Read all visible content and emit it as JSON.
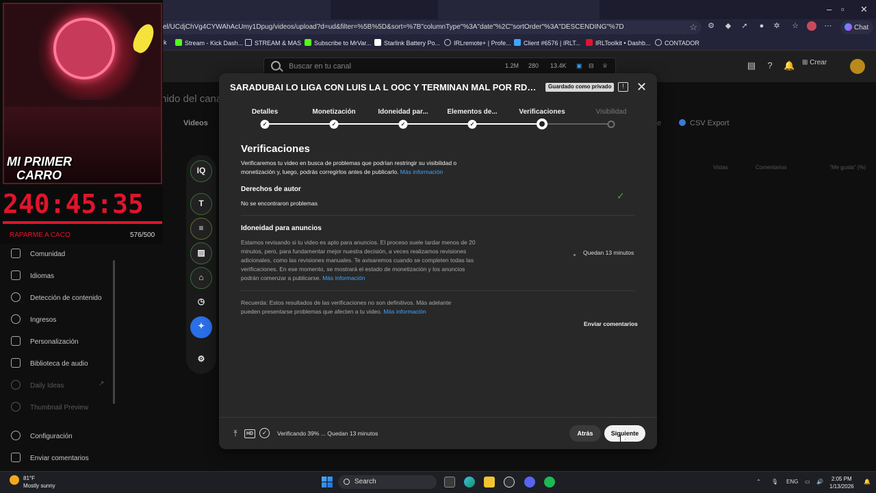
{
  "browser": {
    "url": "el/UCdjChVg4CYWAhAcUmy1Dpug/videos/upload?d=ud&filter=%5B%5D&sort=%7B\"columnType\"%3A\"date\"%2C\"sortOrder\"%3A\"DESCENDING\"%7D",
    "chat_label": "Chat",
    "bookmarks": [
      {
        "label": "Stream - Kick Dash...",
        "color": "#53fc18"
      },
      {
        "label": "STREAM & MAS",
        "color": "#cccccc"
      },
      {
        "label": "Subscribe to MrVar...",
        "color": "#53fc18"
      },
      {
        "label": "Starlink Battery Po...",
        "color": "#ffffff"
      },
      {
        "label": "IRLremote+ | Profe...",
        "color": "#cccccc"
      },
      {
        "label": "Client #6576 | IRLT...",
        "color": "#3ea6ff"
      },
      {
        "label": "IRLToolkit • Dashb...",
        "color": "#e0142c"
      },
      {
        "label": "CONTADOR",
        "color": "#cccccc"
      }
    ],
    "bookmark_prefix": "k"
  },
  "studio": {
    "search_placeholder": "Buscar en tu canal",
    "stats": {
      "subs": "1.2M",
      "videos": "280",
      "views": "13.4K"
    },
    "crear_label": "Crear",
    "page_title_fragment": "nido del cana",
    "tab_vivo_fragment": "n",
    "tab_videos": "Videos",
    "tab_fragment_e": "e",
    "csv_export": "CSV Export",
    "columns": [
      "Vistas",
      "Comentarios",
      "\"Me gusta\" (%)"
    ]
  },
  "sidebar": {
    "items": [
      {
        "label": "Comunidad",
        "dim": false
      },
      {
        "label": "Idiomas",
        "dim": false
      },
      {
        "label": "Detección de contenido",
        "dim": false
      },
      {
        "label": "Ingresos",
        "dim": false
      },
      {
        "label": "Personalización",
        "dim": false
      },
      {
        "label": "Biblioteca de audio",
        "dim": false
      },
      {
        "label": "Daily Ideas",
        "dim": true
      },
      {
        "label": "Thumbnail Preview",
        "dim": true
      },
      {
        "label": "Configuración",
        "dim": false
      },
      {
        "label": "Enviar comentarios",
        "dim": false
      }
    ]
  },
  "overlay": {
    "title_line1": "MI PRIMER",
    "title_line2": "CARRO",
    "timer": "240:45:35",
    "sub_label": "RAPARME A CACO",
    "sub_count": "576/500"
  },
  "tools": {
    "iq_label": "IQ",
    "text_label": "T"
  },
  "modal": {
    "title": "SARADUBAI LO LIGA CON LUIS LA L OOC Y TERMINAN MAL POR RDJAVI ...",
    "badge": "Guardado como privado",
    "steps": [
      {
        "label": "Detalles",
        "state": "done"
      },
      {
        "label": "Monetización",
        "state": "done"
      },
      {
        "label": "Idoneidad par...",
        "state": "done"
      },
      {
        "label": "Elementos de...",
        "state": "done"
      },
      {
        "label": "Verificaciones",
        "state": "current"
      },
      {
        "label": "Visibilidad",
        "state": "todo"
      }
    ],
    "section_title": "Verificaciones",
    "section_desc": "Verificaremos tu video en busca de problemas que podrían restringir su visibilidad o monetización y, luego, podrás corregirlos antes de publicarlo.",
    "more_info": "Más información",
    "copyright_title": "Derechos de autor",
    "copyright_status": "No se encontraron problemas",
    "ads_title": "Idoneidad para anuncios",
    "ads_desc": "Estamos revisando si tu video es apto para anuncios. El proceso suele tardar menos de 20 minutos, pero, para fundamentar mejor nuestra decisión, a veces realizamos revisiones adicionales, como las revisiones manuales. Te avisaremos cuando se completen todas las verificaciones. En ese momento, se mostrará el estado de monetización y los anuncios podrán comenzar a publicarse.",
    "ads_remaining": "Quedan 13 minutos",
    "reminder": "Recuerda: Estos resultados de las verificaciones no son definitivos. Más adelante pueden presentarse problemas que afecten a tu video.",
    "send_feedback": "Enviar comentarios",
    "footer_progress": "Verificando 39% ... Quedan 13 minutos",
    "hd_label": "HD",
    "back_label": "Atrás",
    "next_label": "Siguiente"
  },
  "taskbar": {
    "temp": "81°F",
    "weather": "Mostly sunny",
    "search": "Search",
    "lang": "ENG",
    "time": "2:05 PM",
    "date": "1/13/2026"
  }
}
